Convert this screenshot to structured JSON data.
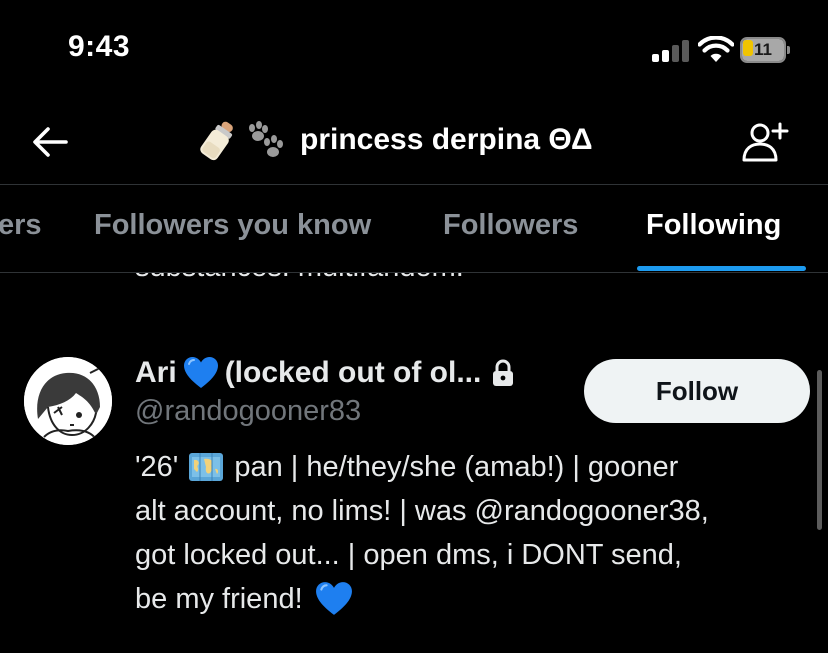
{
  "status_bar": {
    "time": "9:43",
    "battery": "11"
  },
  "header": {
    "title": "princess derpina ΘΔ",
    "back_icon": "back-arrow-icon",
    "action_icon": "add-user-icon",
    "emoji_icons": [
      "baby-bottle-icon",
      "paw-prints-icon"
    ]
  },
  "tabs": [
    {
      "label": "ers",
      "active": false
    },
    {
      "label": "Followers you know",
      "active": false
    },
    {
      "label": "Followers",
      "active": false
    },
    {
      "label": "Following",
      "active": true
    }
  ],
  "prev_item": {
    "bio_tail": "substances. multifandom."
  },
  "user": {
    "name_start": "Ari",
    "name_end": "(locked out of ol...",
    "handle": "@randogooner83",
    "follow_label": "Follow",
    "bio": {
      "line1_start": "'26'",
      "line1_end": "pan | he/they/she (amab!) | gooner",
      "line2": "alt account, no lims! | was @randogooner38,",
      "line3": "got locked out... | open dms, i DONT send,",
      "line4": "be my friend!"
    }
  },
  "colors": {
    "accent": "#1d9bf0",
    "heart": "#1e7ff0",
    "battery": "#f0c400",
    "follow_bg": "#eff3f4"
  }
}
